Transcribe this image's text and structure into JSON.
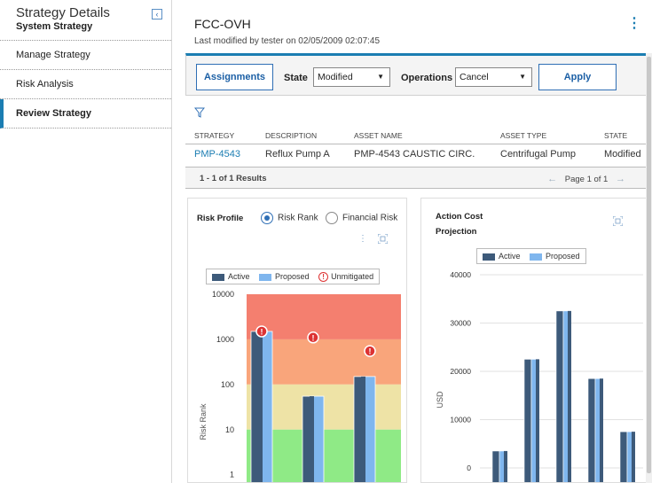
{
  "sidebar": {
    "title": "Strategy Details",
    "subtitle": "System Strategy",
    "collapse_icon": "chevron-left-icon",
    "items": [
      {
        "label": "Manage Strategy"
      },
      {
        "label": "Risk Analysis"
      },
      {
        "label": "Review Strategy",
        "active": true
      }
    ]
  },
  "header": {
    "title": "FCC-OVH",
    "subtitle": "Last modified by tester on 02/05/2009 02:07:45"
  },
  "toolbar": {
    "assignments_label": "Assignments",
    "state_label": "State",
    "state_value": "Modified",
    "operations_label": "Operations",
    "operations_value": "Cancel",
    "apply_label": "Apply"
  },
  "table": {
    "headers": [
      "STRATEGY",
      "DESCRIPTION",
      "ASSET NAME",
      "ASSET TYPE",
      "STATE"
    ],
    "rows": [
      [
        "PMP-4543",
        "Reflux Pump A",
        "PMP-4543 CAUSTIC CIRC.",
        "Centrifugal Pump",
        "Modified"
      ]
    ],
    "results": "1 - 1 of 1 Results",
    "page": "Page 1 of 1"
  },
  "risk_profile": {
    "title": "Risk Profile",
    "radio_risk_rank": "Risk Rank",
    "radio_financial": "Financial Risk",
    "legend_active": "Active",
    "legend_proposed": "Proposed",
    "legend_unmitigated": "Unmitigated"
  },
  "action_cost": {
    "title_line1": "Action Cost",
    "title_line2": "Projection",
    "legend_active": "Active",
    "legend_proposed": "Proposed"
  },
  "colors": {
    "accent": "#1b7db2",
    "active": "#3d5a7a",
    "proposed": "#7fb6ee",
    "zone_red": "#f47f6f",
    "zone_orange": "#f9a57b",
    "zone_yellow": "#eee3a6",
    "zone_green": "#8fea86"
  },
  "chart_data": [
    {
      "type": "bar",
      "scale": "log",
      "ylabel": "Risk Rank",
      "yticks": [
        1,
        10,
        100,
        1000,
        10000
      ],
      "series": [
        {
          "name": "Active",
          "values": [
            1500,
            55,
            150
          ]
        },
        {
          "name": "Proposed",
          "values": [
            1500,
            55,
            150
          ]
        }
      ],
      "unmitigated": [
        1500,
        1100,
        550
      ],
      "zones": [
        {
          "from": 1000,
          "to": 10000,
          "color": "#f47f6f"
        },
        {
          "from": 100,
          "to": 1000,
          "color": "#f9a57b"
        },
        {
          "from": 10,
          "to": 100,
          "color": "#eee3a6"
        },
        {
          "from": 0.5,
          "to": 10,
          "color": "#8fea86"
        }
      ]
    },
    {
      "type": "bar",
      "ylabel": "USD",
      "yticks": [
        0,
        10000,
        20000,
        30000,
        40000
      ],
      "series": [
        {
          "name": "Active",
          "values": [
            3500,
            22500,
            32500,
            18500,
            7500
          ]
        },
        {
          "name": "Proposed",
          "values": [
            3500,
            22500,
            32500,
            18500,
            7500
          ]
        }
      ]
    }
  ]
}
